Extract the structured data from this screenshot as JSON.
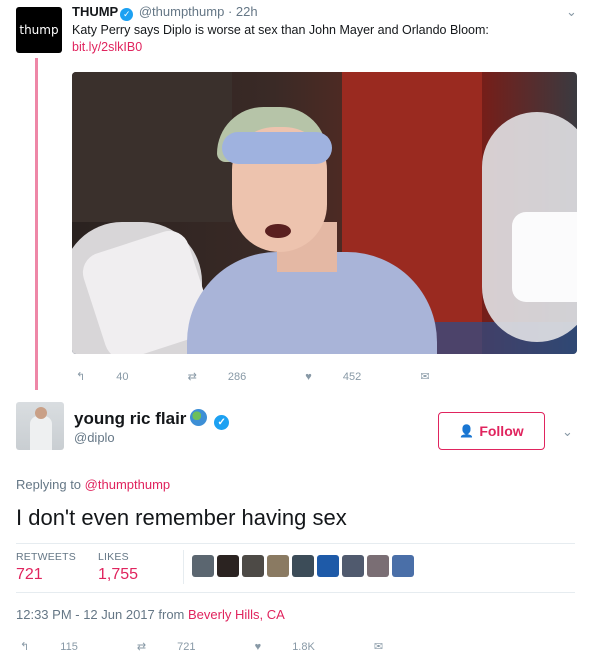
{
  "parent_tweet": {
    "avatar_text": "thump",
    "name": "THUMP",
    "handle": "@thumpthump",
    "dot": "·",
    "time": "22h",
    "text": "Katy Perry says Diplo is worse at sex than John Mayer and Orlando Bloom:",
    "link": "bit.ly/2slkIB0",
    "actions": {
      "replies": "40",
      "retweets": "286",
      "likes": "452"
    }
  },
  "main_tweet": {
    "name": "young ric flair",
    "handle": "@diplo",
    "follow_label": "Follow",
    "replying_prefix": "Replying to",
    "replying_to": "@thumpthump",
    "text": "I don't even remember having sex",
    "stats": {
      "retweets_label": "RETWEETS",
      "retweets": "721",
      "likes_label": "LIKES",
      "likes": "1,755"
    },
    "timestamp": "12:33 PM - 12 Jun 2017 from",
    "location": "Beverly Hills, CA",
    "actions": {
      "replies": "115",
      "retweets": "721",
      "likes": "1.8K"
    }
  },
  "icons": {
    "reply": "↰",
    "retweet": "⇄",
    "like": "♥",
    "message": "✉",
    "chevron": "⌄",
    "verified": "✓",
    "follow_person": "👤"
  },
  "colors": {
    "accent": "#e0245e",
    "verified": "#1da1f2",
    "muted": "#657786"
  },
  "likers": [
    {
      "color": "#5b6670"
    },
    {
      "color": "#2b2321"
    },
    {
      "color": "#4d4a46"
    },
    {
      "color": "#8a7a62"
    },
    {
      "color": "#3c4c58"
    },
    {
      "color": "#1e5aa8"
    },
    {
      "color": "#505a6e"
    },
    {
      "color": "#7a6e74"
    },
    {
      "color": "#4a6fa8"
    }
  ]
}
